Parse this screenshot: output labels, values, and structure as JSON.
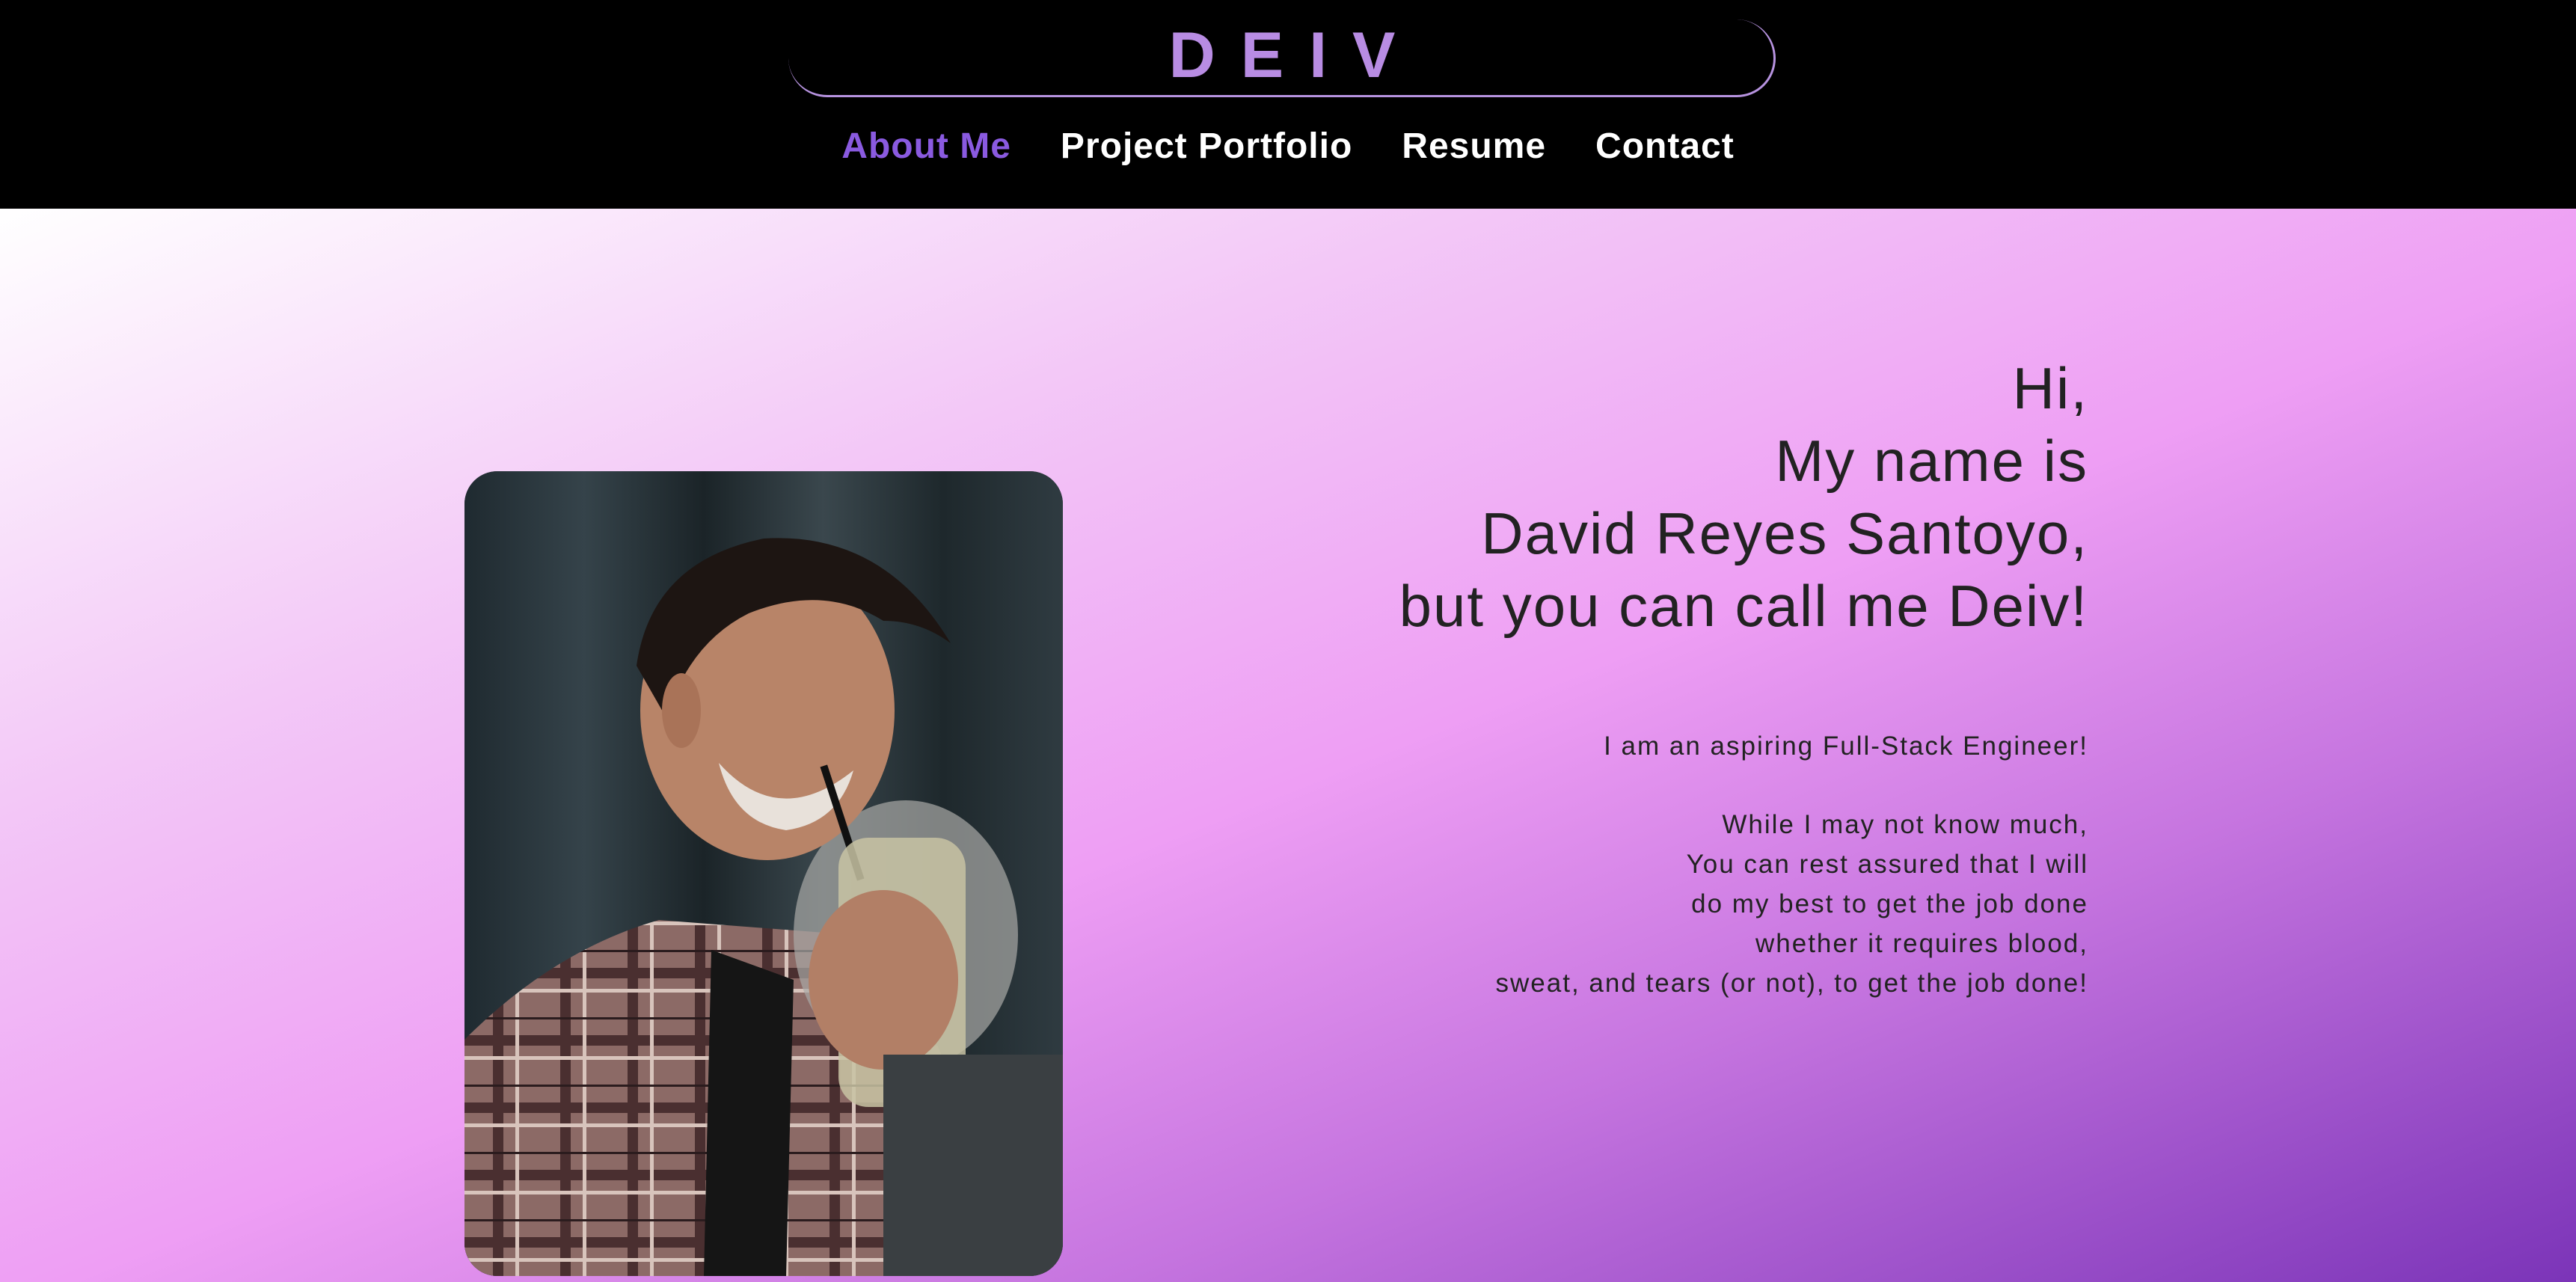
{
  "header": {
    "logo": "DEIV",
    "nav": [
      {
        "label": "About Me",
        "active": true
      },
      {
        "label": "Project Portfolio",
        "active": false
      },
      {
        "label": "Resume",
        "active": false
      },
      {
        "label": "Contact",
        "active": false
      }
    ]
  },
  "hero": {
    "intro_lines": [
      "Hi,",
      "My name is",
      "David Reyes Santoyo,",
      "but you can call me Deiv!"
    ],
    "tagline": "I am an aspiring Full-Stack Engineer!",
    "bio_lines": [
      "While I may not know much,",
      "You can rest assured that I will",
      "do my best to get the job done",
      "whether it requires blood,",
      "sweat, and tears (or not), to get the job done!"
    ]
  },
  "colors": {
    "accent": "#8a5ae0",
    "logo": "#b88ce3",
    "header_bg": "#000000",
    "text": "#222222"
  },
  "icons": {
    "profile_photo": "portrait-photo"
  }
}
